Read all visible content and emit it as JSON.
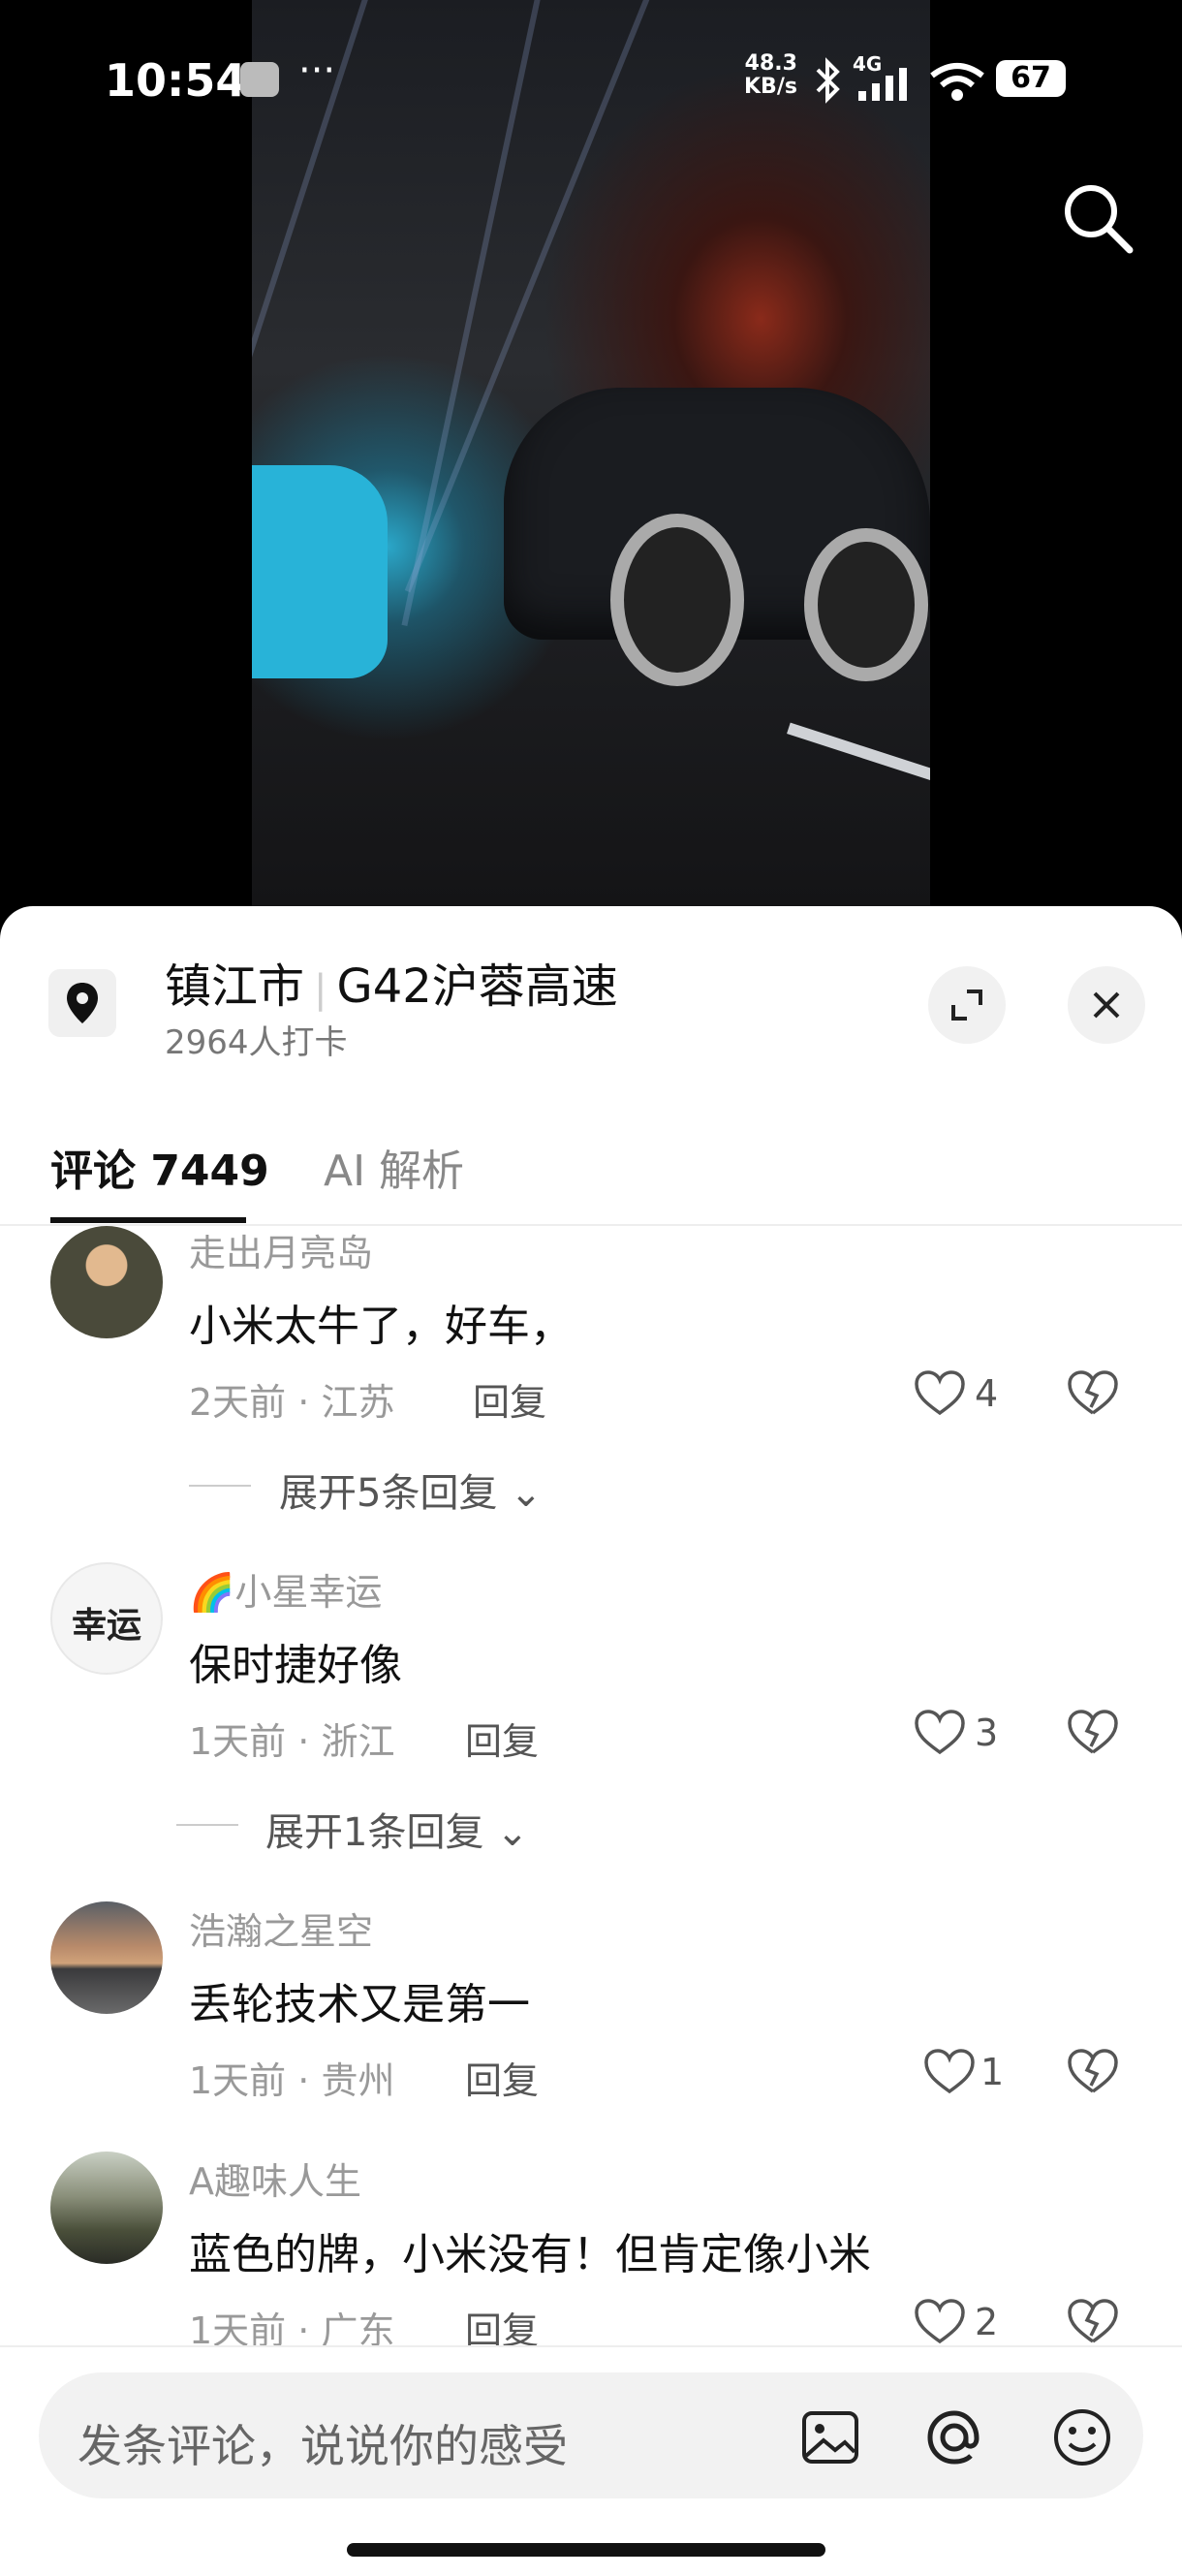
{
  "status_bar": {
    "time": "10:54",
    "net_speed_value": "48.3",
    "net_speed_unit": "KB/s",
    "network": "4G",
    "battery": "67"
  },
  "location": {
    "city": "镇江市",
    "road": "G42沪蓉高速",
    "checkins": "2964人打卡"
  },
  "tabs": [
    {
      "label": "评论 7449",
      "active": true
    },
    {
      "label": "AI 解析",
      "active": false
    }
  ],
  "comments": [
    {
      "user": "走出月亮岛",
      "text": "小米太牛了，好车，",
      "time": "2天前",
      "region": "江苏",
      "reply": "回复",
      "likes": "4",
      "expand": "展开5条回复"
    },
    {
      "user": "🌈小星幸运",
      "text": "保时捷好像",
      "time": "1天前",
      "region": "浙江",
      "reply": "回复",
      "likes": "3",
      "expand": "展开1条回复"
    },
    {
      "user": "浩瀚之星空",
      "text": "丢轮技术又是第一",
      "time": "1天前",
      "region": "贵州",
      "reply": "回复",
      "likes": "1"
    },
    {
      "user": "A趣味人生",
      "text": "蓝色的牌，小米没有！但肯定像小米",
      "time": "1天前",
      "region": "广东",
      "reply": "回复",
      "likes": "2"
    }
  ],
  "avatar_text_2": "幸运",
  "input": {
    "placeholder": "发条评论，说说你的感受"
  },
  "colors": {
    "accent": "#111111",
    "muted": "#999999",
    "sheet_bg": "#ffffff"
  }
}
